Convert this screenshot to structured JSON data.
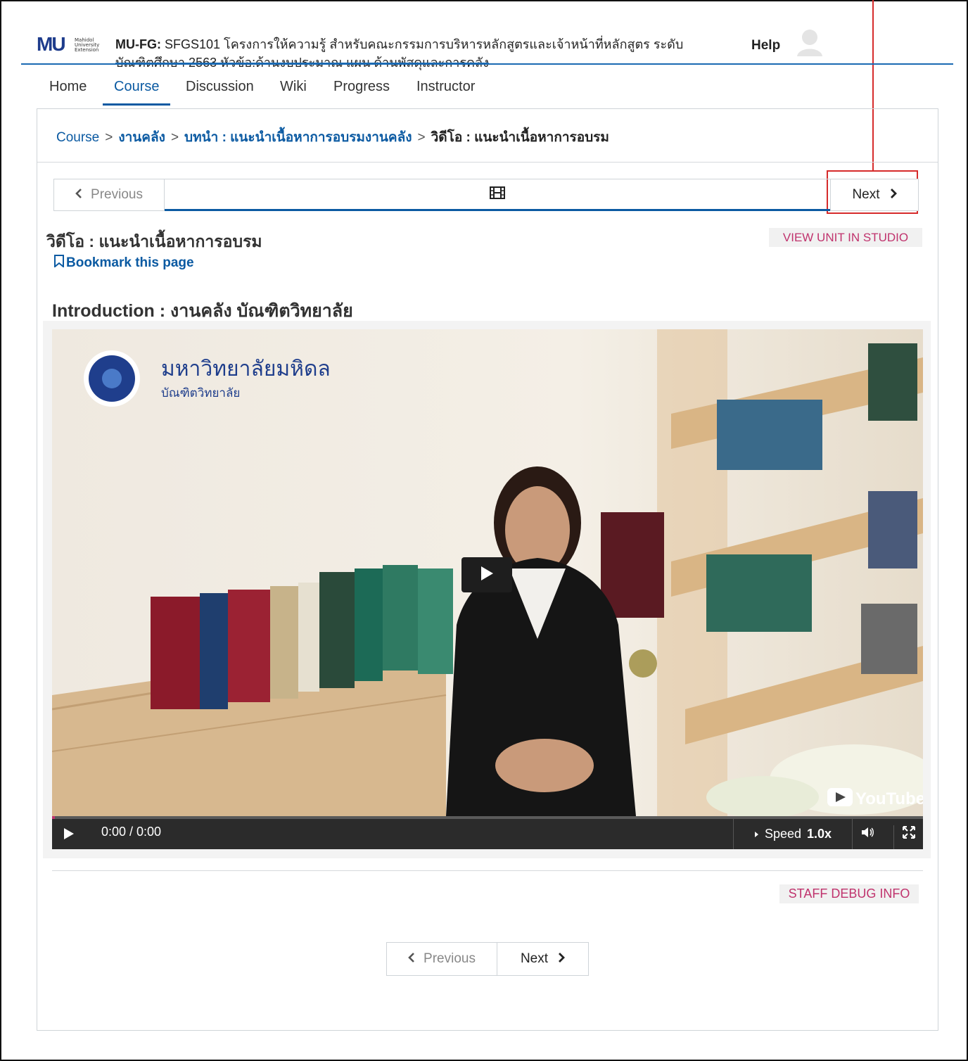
{
  "header": {
    "logo_text": "MU",
    "logo_sub": "Mahidol University Extension",
    "course_code": "MU-FG:",
    "course_name_line1": "SFGS101 โครงการให้ความรู้ สำหรับคณะกรรมการบริหารหลักสูตรและเจ้าหน้าที่หลักสูตร ระดับ",
    "course_name_line2": "บัณฑิตศึกษา 2563 หัวข้อ:ด้านงบประมาณ แผน ด้านพัสดุและการคลัง",
    "help_label": "Help"
  },
  "nav": {
    "tabs": [
      {
        "label": "Home"
      },
      {
        "label": "Course"
      },
      {
        "label": "Discussion"
      },
      {
        "label": "Wiki"
      },
      {
        "label": "Progress"
      },
      {
        "label": "Instructor"
      }
    ],
    "active": "Course"
  },
  "breadcrumb": {
    "items": [
      "Course",
      "งานคลัง",
      "บทนำ : แนะนำเนื้อหาการอบรมงานคลัง",
      "วิดีโอ : แนะนำเนื้อหาการอบรม"
    ],
    "separator": ">"
  },
  "sequence": {
    "previous_label": "Previous",
    "next_label": "Next",
    "unit_icon": "film-icon"
  },
  "unit": {
    "title": "วิดีโอ : แนะนำเนื้อหาการอบรม",
    "studio_button": "VIEW UNIT IN STUDIO",
    "bookmark_label": "Bookmark this page",
    "video_heading": "Introduction : งานคลัง บัณฑิตวิทยาลัย"
  },
  "video": {
    "overlay_title": "มหาวิทยาลัยมหิดล",
    "overlay_subtitle": "บัณฑิตวิทยาลัย",
    "youtube_label": "YouTube",
    "time": "0:00 / 0:00",
    "speed_label": "Speed",
    "speed_value": "1.0x",
    "progress": 0
  },
  "footer": {
    "debug_button": "STAFF DEBUG INFO",
    "previous_label": "Previous",
    "next_label": "Next"
  },
  "colors": {
    "link_blue": "#0b5aa2",
    "accent_pink": "#c0336d",
    "annotation_red": "#d62b2b"
  }
}
